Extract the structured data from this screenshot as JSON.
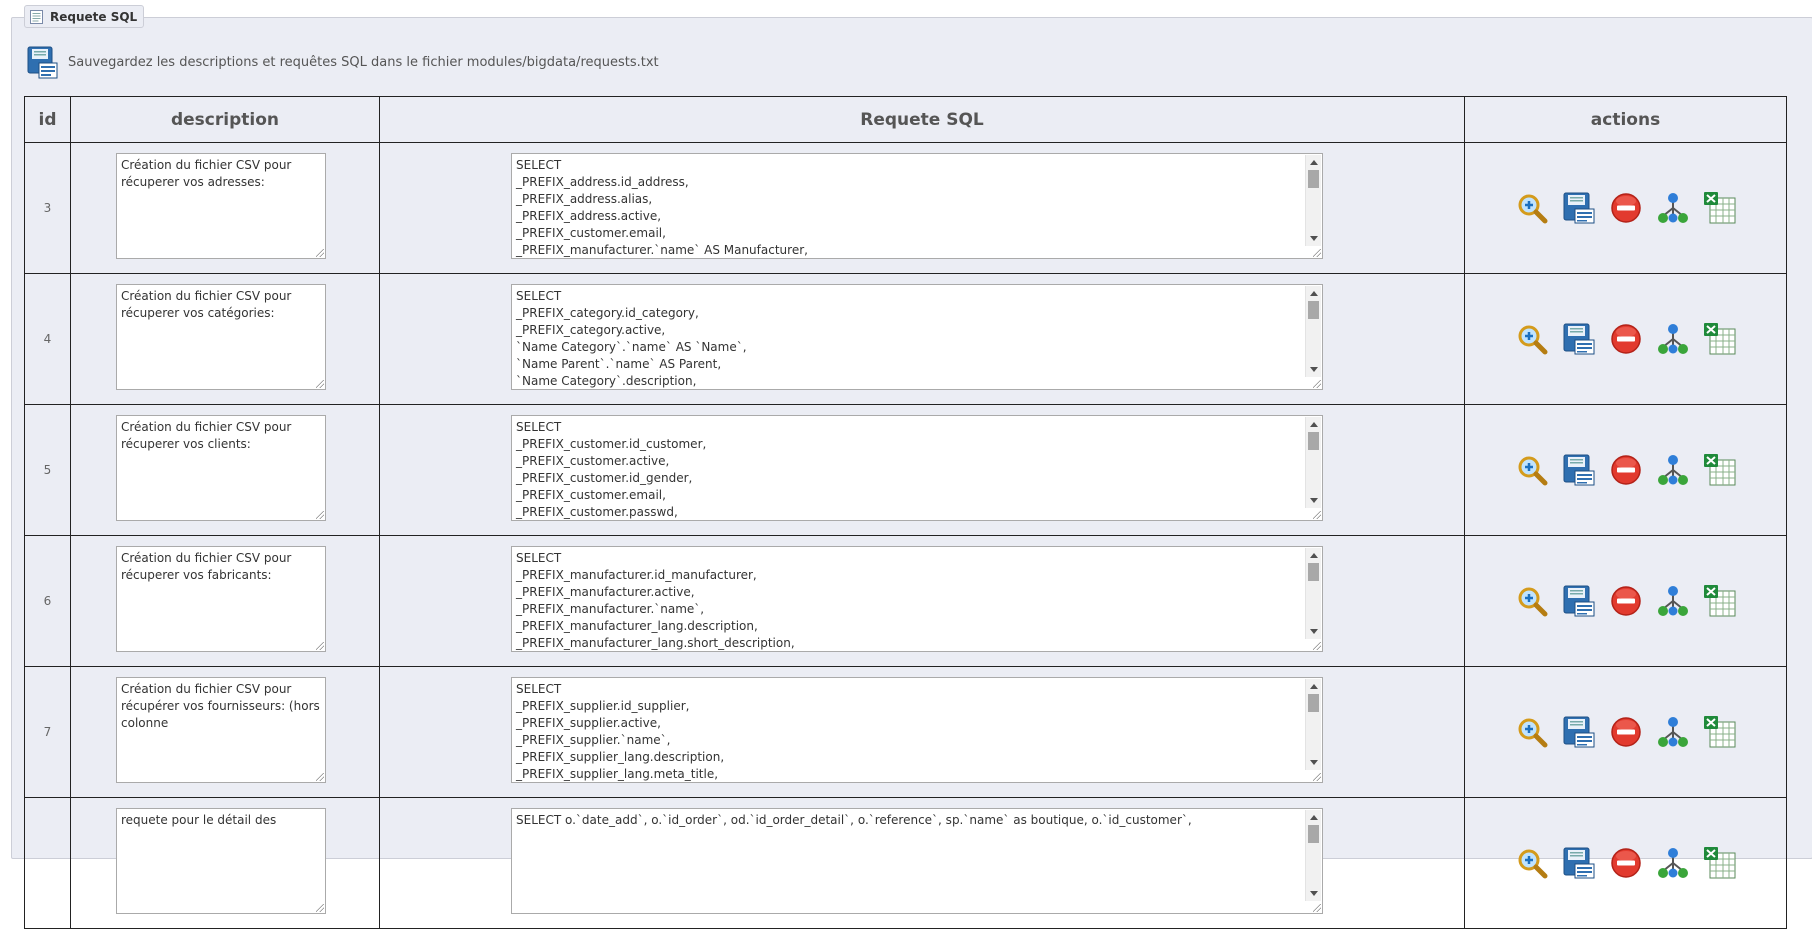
{
  "panel": {
    "legend": "Requete SQL",
    "legend_icon": "document-icon",
    "hint": "Sauvegardez les descriptions et requêtes SQL dans le fichier modules/bigdata/requests.txt",
    "hint_icon": "save-icon"
  },
  "table": {
    "headers": [
      "id",
      "description",
      "Requete SQL",
      "actions"
    ],
    "rows": [
      {
        "id": "3",
        "description": "Création du fichier CSV pour récuperer vos adresses:",
        "sql": "SELECT\n_PREFIX_address.id_address,\n_PREFIX_address.alias,\n_PREFIX_address.active,\n_PREFIX_customer.email,\n_PREFIX_manufacturer.`name` AS Manufacturer,"
      },
      {
        "id": "4",
        "description": "Création du fichier CSV pour récuperer vos catégories:",
        "sql": "SELECT\n_PREFIX_category.id_category,\n_PREFIX_category.active,\n`Name Category`.`name` AS `Name`,\n`Name Parent`.`name` AS Parent,\n`Name Category`.description,"
      },
      {
        "id": "5",
        "description": "Création du fichier CSV pour récuperer vos clients:",
        "sql": "SELECT\n_PREFIX_customer.id_customer,\n_PREFIX_customer.active,\n_PREFIX_customer.id_gender,\n_PREFIX_customer.email,\n_PREFIX_customer.passwd,"
      },
      {
        "id": "6",
        "description": "Création du fichier CSV pour récuperer vos fabricants:",
        "sql": "SELECT\n_PREFIX_manufacturer.id_manufacturer,\n_PREFIX_manufacturer.active,\n_PREFIX_manufacturer.`name`,\n_PREFIX_manufacturer_lang.description,\n_PREFIX_manufacturer_lang.short_description,"
      },
      {
        "id": "7",
        "description": "Création du fichier CSV pour récupérer vos fournisseurs: (hors colonne",
        "sql": "SELECT\n_PREFIX_supplier.id_supplier,\n_PREFIX_supplier.active,\n_PREFIX_supplier.`name`,\n_PREFIX_supplier_lang.description,\n_PREFIX_supplier_lang.meta_title,"
      },
      {
        "id": "",
        "description": "requete pour le détail des",
        "sql": "SELECT o.`date_add`, o.`id_order`, od.`id_order_detail`, o.`reference`, sp.`name` as boutique, o.`id_customer`,"
      }
    ],
    "action_icons": [
      "zoom-icon",
      "save-icon",
      "delete-icon",
      "sitemap-icon",
      "excel-icon"
    ]
  }
}
